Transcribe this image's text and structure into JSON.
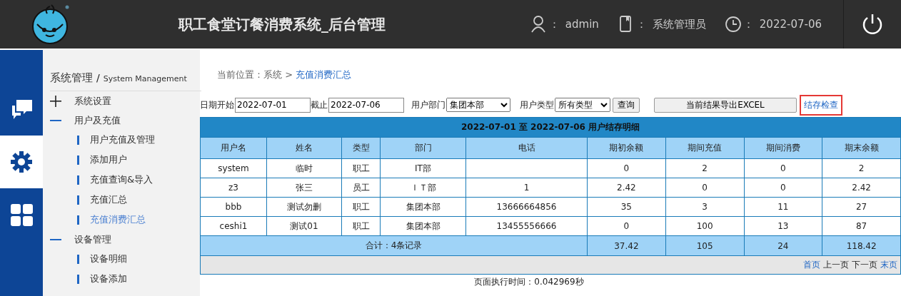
{
  "header": {
    "title": "职工食堂订餐消费系统_后台管理",
    "items": [
      {
        "kind": "user",
        "separator": "：",
        "value": "admin"
      },
      {
        "kind": "role",
        "separator": "：",
        "value": "系统管理员"
      },
      {
        "kind": "date",
        "separator": "：",
        "value": "2022-07-06"
      }
    ]
  },
  "rail": [
    {
      "kind": "chat",
      "selected": false
    },
    {
      "kind": "gear",
      "selected": true
    },
    {
      "kind": "grid",
      "selected": false
    }
  ],
  "sidebar": {
    "title": "系统管理",
    "separator": "/",
    "subtitle": "System Management",
    "items": [
      {
        "label": "系统设置",
        "expanded": false
      },
      {
        "label": "用户及充值",
        "expanded": true,
        "children": [
          {
            "label": "用户充值及管理",
            "selected": false
          },
          {
            "label": "添加用户",
            "selected": false
          },
          {
            "label": "充值查询&导入",
            "selected": false
          },
          {
            "label": "充值汇总",
            "selected": false
          },
          {
            "label": "充值消费汇总",
            "selected": true
          }
        ]
      },
      {
        "label": "设备管理",
        "expanded": true,
        "children": [
          {
            "label": "设备明细",
            "selected": false
          },
          {
            "label": "设备添加",
            "selected": false
          }
        ]
      }
    ]
  },
  "breadcrumb": {
    "label": "当前位置：系统 >",
    "current": "充值消费汇总"
  },
  "filters": {
    "start_label": "日期开始",
    "start": "2022-07-01",
    "end_label": "截止",
    "end": "2022-07-06",
    "dept_label": "用户部门",
    "dept": "集团本部",
    "type_label": "用户类型",
    "type": "所有类型",
    "query": "查询",
    "export": "当前结果导出EXCEL",
    "check": "结存检查"
  },
  "table": {
    "title": "2022-07-01 至 2022-07-06 用户结存明细",
    "columns": [
      "用户名",
      "姓名",
      "类型",
      "部门",
      "电话",
      "期初余额",
      "期间充值",
      "期间消费",
      "期末余额"
    ],
    "rows": [
      [
        "system",
        "临时",
        "职工",
        "IT部",
        "",
        "0",
        "2",
        "0",
        "2"
      ],
      [
        "z3",
        "张三",
        "员工",
        "ＩＴ部",
        "1",
        "2.42",
        "0",
        "0",
        "2.42"
      ],
      [
        "bbb",
        "测试勿删",
        "职工",
        "集团本部",
        "13666664856",
        "35",
        "3",
        "11",
        "27"
      ],
      [
        "ceshi1",
        "测试01",
        "职工",
        "集团本部",
        "13455556666",
        "0",
        "100",
        "13",
        "87"
      ]
    ],
    "total": {
      "label": "合计：4条记录",
      "values": [
        "37.42",
        "105",
        "24",
        "118.42"
      ]
    },
    "pager": [
      {
        "label": "首页",
        "disabled": false
      },
      {
        "label": "上一页",
        "disabled": true
      },
      {
        "label": "下一页",
        "disabled": true
      },
      {
        "label": "末页",
        "disabled": false
      }
    ]
  },
  "exec_time": "页面执行时间：0.042969秒"
}
